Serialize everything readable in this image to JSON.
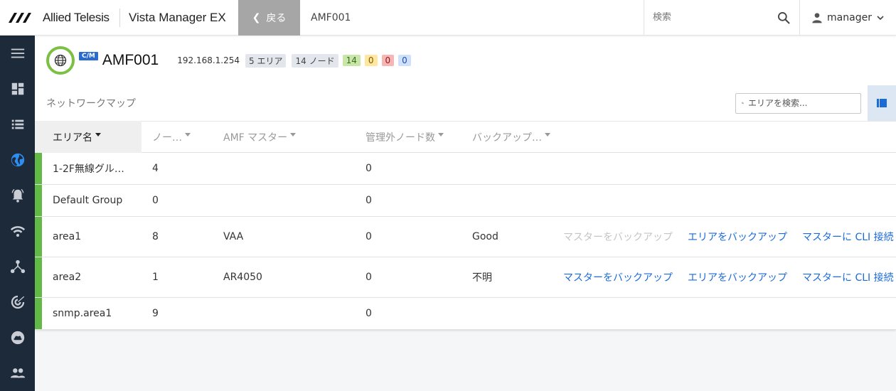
{
  "header": {
    "brand": "Allied Telesis",
    "app_title": "Vista Manager EX",
    "back_label": "戻る",
    "breadcrumb": "AMF001",
    "search_placeholder": "検索",
    "user": "manager"
  },
  "sidebar": {
    "items": [
      {
        "icon": "menu-icon"
      },
      {
        "icon": "dashboard-icon"
      },
      {
        "icon": "list-icon"
      },
      {
        "icon": "globe-icon",
        "active": true
      },
      {
        "icon": "alarm-bell-icon"
      },
      {
        "icon": "wifi-icon"
      },
      {
        "icon": "topology-icon"
      },
      {
        "icon": "radar-icon"
      },
      {
        "icon": "cloud-icon"
      },
      {
        "icon": "users-icon"
      }
    ]
  },
  "node": {
    "badge": "C/M",
    "name": "AMF001",
    "ip": "192.168.1.254",
    "areas": "5 エリア",
    "nodes": "14 ノード",
    "count_green": "14",
    "count_yellow": "0",
    "count_red": "0",
    "count_blue": "0"
  },
  "map": {
    "title": "ネットワークマップ",
    "search_placeholder": "エリアを検索..."
  },
  "table": {
    "headers": {
      "name": "エリア名",
      "nodes": "ノー…",
      "master": "AMF マスター",
      "unmanaged": "管理外ノード数",
      "backup": "バックアップ…"
    },
    "actions": {
      "backup_master": "マスターをバックアップ",
      "backup_area": "エリアをバックアップ",
      "cli_connect": "マスターに CLI 接続"
    },
    "rows": [
      {
        "name": "1-2F無線グル…",
        "nodes": "4",
        "master": "",
        "unmanaged": "0",
        "backup": ""
      },
      {
        "name": "Default Group",
        "nodes": "0",
        "master": "",
        "unmanaged": "0",
        "backup": ""
      },
      {
        "name": "area1",
        "nodes": "8",
        "master": "VAA",
        "unmanaged": "0",
        "backup": "Good"
      },
      {
        "name": "area2",
        "nodes": "1",
        "master": "AR4050",
        "unmanaged": "0",
        "backup": "不明"
      },
      {
        "name": "snmp.area1",
        "nodes": "9",
        "master": "",
        "unmanaged": "0",
        "backup": ""
      }
    ]
  },
  "colors": {
    "sidebar_bg": "#1d2a3a",
    "accent": "#2f8cf0",
    "link": "#1a6ad8",
    "status_green": "#63b946"
  }
}
